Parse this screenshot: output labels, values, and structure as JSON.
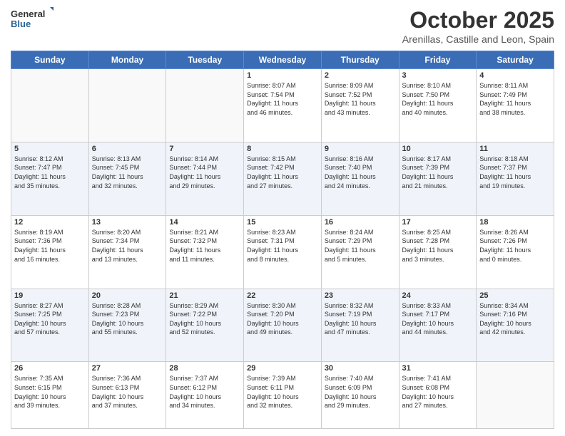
{
  "header": {
    "logo_general": "General",
    "logo_blue": "Blue",
    "month_title": "October 2025",
    "location": "Arenillas, Castille and Leon, Spain"
  },
  "days_of_week": [
    "Sunday",
    "Monday",
    "Tuesday",
    "Wednesday",
    "Thursday",
    "Friday",
    "Saturday"
  ],
  "weeks": [
    {
      "days": [
        {
          "num": "",
          "info": ""
        },
        {
          "num": "",
          "info": ""
        },
        {
          "num": "",
          "info": ""
        },
        {
          "num": "1",
          "info": "Sunrise: 8:07 AM\nSunset: 7:54 PM\nDaylight: 11 hours\nand 46 minutes."
        },
        {
          "num": "2",
          "info": "Sunrise: 8:09 AM\nSunset: 7:52 PM\nDaylight: 11 hours\nand 43 minutes."
        },
        {
          "num": "3",
          "info": "Sunrise: 8:10 AM\nSunset: 7:50 PM\nDaylight: 11 hours\nand 40 minutes."
        },
        {
          "num": "4",
          "info": "Sunrise: 8:11 AM\nSunset: 7:49 PM\nDaylight: 11 hours\nand 38 minutes."
        }
      ]
    },
    {
      "days": [
        {
          "num": "5",
          "info": "Sunrise: 8:12 AM\nSunset: 7:47 PM\nDaylight: 11 hours\nand 35 minutes."
        },
        {
          "num": "6",
          "info": "Sunrise: 8:13 AM\nSunset: 7:45 PM\nDaylight: 11 hours\nand 32 minutes."
        },
        {
          "num": "7",
          "info": "Sunrise: 8:14 AM\nSunset: 7:44 PM\nDaylight: 11 hours\nand 29 minutes."
        },
        {
          "num": "8",
          "info": "Sunrise: 8:15 AM\nSunset: 7:42 PM\nDaylight: 11 hours\nand 27 minutes."
        },
        {
          "num": "9",
          "info": "Sunrise: 8:16 AM\nSunset: 7:40 PM\nDaylight: 11 hours\nand 24 minutes."
        },
        {
          "num": "10",
          "info": "Sunrise: 8:17 AM\nSunset: 7:39 PM\nDaylight: 11 hours\nand 21 minutes."
        },
        {
          "num": "11",
          "info": "Sunrise: 8:18 AM\nSunset: 7:37 PM\nDaylight: 11 hours\nand 19 minutes."
        }
      ]
    },
    {
      "days": [
        {
          "num": "12",
          "info": "Sunrise: 8:19 AM\nSunset: 7:36 PM\nDaylight: 11 hours\nand 16 minutes."
        },
        {
          "num": "13",
          "info": "Sunrise: 8:20 AM\nSunset: 7:34 PM\nDaylight: 11 hours\nand 13 minutes."
        },
        {
          "num": "14",
          "info": "Sunrise: 8:21 AM\nSunset: 7:32 PM\nDaylight: 11 hours\nand 11 minutes."
        },
        {
          "num": "15",
          "info": "Sunrise: 8:23 AM\nSunset: 7:31 PM\nDaylight: 11 hours\nand 8 minutes."
        },
        {
          "num": "16",
          "info": "Sunrise: 8:24 AM\nSunset: 7:29 PM\nDaylight: 11 hours\nand 5 minutes."
        },
        {
          "num": "17",
          "info": "Sunrise: 8:25 AM\nSunset: 7:28 PM\nDaylight: 11 hours\nand 3 minutes."
        },
        {
          "num": "18",
          "info": "Sunrise: 8:26 AM\nSunset: 7:26 PM\nDaylight: 11 hours\nand 0 minutes."
        }
      ]
    },
    {
      "days": [
        {
          "num": "19",
          "info": "Sunrise: 8:27 AM\nSunset: 7:25 PM\nDaylight: 10 hours\nand 57 minutes."
        },
        {
          "num": "20",
          "info": "Sunrise: 8:28 AM\nSunset: 7:23 PM\nDaylight: 10 hours\nand 55 minutes."
        },
        {
          "num": "21",
          "info": "Sunrise: 8:29 AM\nSunset: 7:22 PM\nDaylight: 10 hours\nand 52 minutes."
        },
        {
          "num": "22",
          "info": "Sunrise: 8:30 AM\nSunset: 7:20 PM\nDaylight: 10 hours\nand 49 minutes."
        },
        {
          "num": "23",
          "info": "Sunrise: 8:32 AM\nSunset: 7:19 PM\nDaylight: 10 hours\nand 47 minutes."
        },
        {
          "num": "24",
          "info": "Sunrise: 8:33 AM\nSunset: 7:17 PM\nDaylight: 10 hours\nand 44 minutes."
        },
        {
          "num": "25",
          "info": "Sunrise: 8:34 AM\nSunset: 7:16 PM\nDaylight: 10 hours\nand 42 minutes."
        }
      ]
    },
    {
      "days": [
        {
          "num": "26",
          "info": "Sunrise: 7:35 AM\nSunset: 6:15 PM\nDaylight: 10 hours\nand 39 minutes."
        },
        {
          "num": "27",
          "info": "Sunrise: 7:36 AM\nSunset: 6:13 PM\nDaylight: 10 hours\nand 37 minutes."
        },
        {
          "num": "28",
          "info": "Sunrise: 7:37 AM\nSunset: 6:12 PM\nDaylight: 10 hours\nand 34 minutes."
        },
        {
          "num": "29",
          "info": "Sunrise: 7:39 AM\nSunset: 6:11 PM\nDaylight: 10 hours\nand 32 minutes."
        },
        {
          "num": "30",
          "info": "Sunrise: 7:40 AM\nSunset: 6:09 PM\nDaylight: 10 hours\nand 29 minutes."
        },
        {
          "num": "31",
          "info": "Sunrise: 7:41 AM\nSunset: 6:08 PM\nDaylight: 10 hours\nand 27 minutes."
        },
        {
          "num": "",
          "info": ""
        }
      ]
    }
  ]
}
